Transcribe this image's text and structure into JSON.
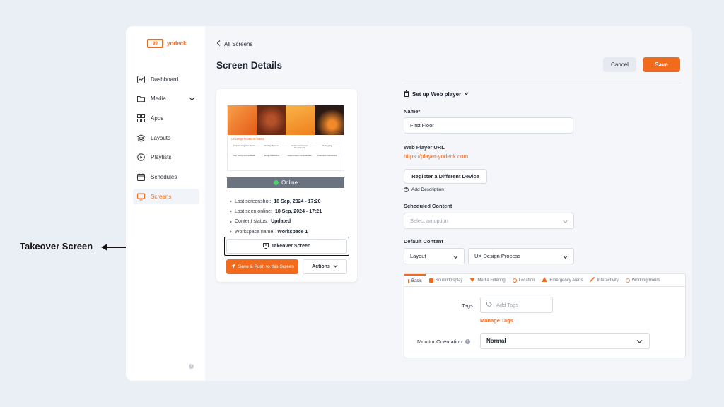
{
  "callout": {
    "label": "Takeover Screen"
  },
  "logo": {
    "mark": "99",
    "text": "yodeck"
  },
  "sidebar": {
    "items": [
      {
        "label": "Dashboard",
        "icon": "dashboard-icon"
      },
      {
        "label": "Media",
        "icon": "folder-icon"
      },
      {
        "label": "Apps",
        "icon": "apps-grid-icon"
      },
      {
        "label": "Layouts",
        "icon": "layers-icon"
      },
      {
        "label": "Playlists",
        "icon": "play-circle-icon"
      },
      {
        "label": "Schedules",
        "icon": "calendar-icon"
      },
      {
        "label": "Screens",
        "icon": "monitor-icon"
      }
    ],
    "active": "Screens"
  },
  "header": {
    "back_label": "All Screens",
    "title": "Screen Details",
    "cancel_label": "Cancel",
    "save_label": "Save"
  },
  "preview": {
    "title": "UX Design Process At Yodeck",
    "steps": [
      "Understanding User Needs",
      "Defining Objectives",
      "Ideation And Concept Development",
      "Prototyping",
      "User Testing And Feedback",
      "Design Refinement",
      "Implementation And Evaluation",
      "Continuous Improvement"
    ]
  },
  "status": {
    "label": "Online",
    "color": "#4bd16a"
  },
  "info": {
    "last_screenshot_label": "Last screenshot:",
    "last_screenshot_value": "18 Sep, 2024 - 17:20",
    "last_seen_label": "Last seen online:",
    "last_seen_value": "18 Sep, 2024 - 17:21",
    "content_status_label": "Content status:",
    "content_status_value": "Updated",
    "workspace_label": "Workspace name:",
    "workspace_value": "Workspace 1"
  },
  "actions": {
    "takeover_label": "Takeover Screen",
    "push_label": "Save & Push to this Screen",
    "actions_label": "Actions"
  },
  "form": {
    "setup_label": "Set up Web player",
    "name_label": "Name*",
    "name_value": "First Floor",
    "url_label": "Web Player URL",
    "url_value": "https://player-yodeck.com",
    "register_label": "Register a Different Device",
    "add_description_label": "Add Description",
    "scheduled_label": "Scheduled Content",
    "scheduled_placeholder": "Select an option",
    "default_label": "Default Content",
    "default_type": "Layout",
    "default_value": "UX Design Process"
  },
  "tabs": [
    {
      "label": "Basic",
      "active": true
    },
    {
      "label": "Sound/Display"
    },
    {
      "label": "Media Filtering"
    },
    {
      "label": "Location"
    },
    {
      "label": "Emergency Alerts"
    },
    {
      "label": "Interactivity"
    },
    {
      "label": "Working Hours"
    }
  ],
  "basic": {
    "tags_label": "Tags",
    "tags_placeholder": "Add Tags",
    "manage_tags_label": "Manage Tags",
    "orientation_label": "Monitor Orientation",
    "orientation_value": "Normal"
  },
  "colors": {
    "accent": "#f26b1d",
    "status_bar": "#6b7280",
    "online": "#4bd16a"
  }
}
